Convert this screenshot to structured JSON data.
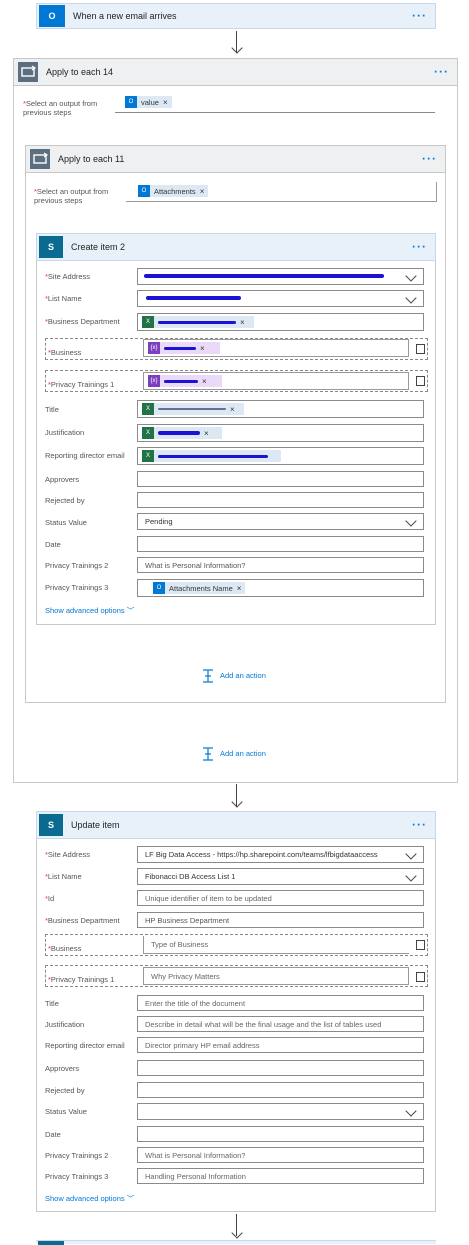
{
  "trigger": {
    "title": "When a new email arrives"
  },
  "apply14": {
    "title": "Apply to each 14",
    "select_label": "Select an output from previous steps",
    "token": "value"
  },
  "apply11": {
    "title": "Apply to each 11",
    "select_label": "Select an output from previous steps",
    "token": "Attachments"
  },
  "create": {
    "title": "Create item 2",
    "fields": {
      "site_address": "Site Address",
      "list_name": "List Name",
      "business_department": "Business Department",
      "business": "Business",
      "privacy1": "Privacy Trainings 1",
      "title": "Title",
      "justification": "Justification",
      "reporting": "Reporting director email",
      "approvers": "Approvers",
      "rejected": "Rejected by",
      "status": "Status Value",
      "date": "Date",
      "privacy2": "Privacy Trainings 2",
      "privacy3": "Privacy Trainings 3"
    },
    "values": {
      "status": "Pending",
      "privacy2": "What is Personal Information?",
      "privacy3_token": "Attachments Name"
    },
    "advanced": "Show advanced options",
    "add_action_inner": "Add an action"
  },
  "outer_add_action": "Add an action",
  "update": {
    "title": "Update item",
    "fields": {
      "site_address": "Site Address",
      "list_name": "List Name",
      "id": "Id",
      "business_department": "Business Department",
      "business": "Business",
      "privacy1": "Privacy Trainings 1",
      "title": "Title",
      "justification": "Justification",
      "reporting": "Reporting director email",
      "approvers": "Approvers",
      "rejected": "Rejected by",
      "status": "Status Value",
      "date": "Date",
      "privacy2": "Privacy Trainings 2",
      "privacy3": "Privacy Trainings 3"
    },
    "values": {
      "site_address": "LF Big Data Access - https://hp.sharepoint.com/teams/lfbigdataaccess",
      "list_name": "Fibonacci DB Access List 1",
      "id": "Unique identifier of item to be updated",
      "business_department": "HP Business Department",
      "business": "Type of Business",
      "privacy1": "Why Privacy Matters",
      "title": "Enter the title of the document",
      "justification": "Describe in detail what will be the final usage and the list of tables used",
      "reporting": "Director primary HP email address",
      "privacy2": "What is Personal Information?",
      "privacy3": "Handling Personal Information"
    },
    "advanced": "Show advanced options"
  },
  "colors": {
    "accent": "#0078d4",
    "header_bg": "#e8f1fa",
    "loop_header": "#eef0f2",
    "required": "#d13438",
    "excel": "#217346",
    "variable": "#7b3fbf",
    "redaction": "#1a13d6"
  },
  "icons": [
    "outlook-icon",
    "loop-icon",
    "sharepoint-icon",
    "excel-icon",
    "variable-icon",
    "chevron-down-icon",
    "delete-icon",
    "add-action-icon",
    "close-icon"
  ]
}
